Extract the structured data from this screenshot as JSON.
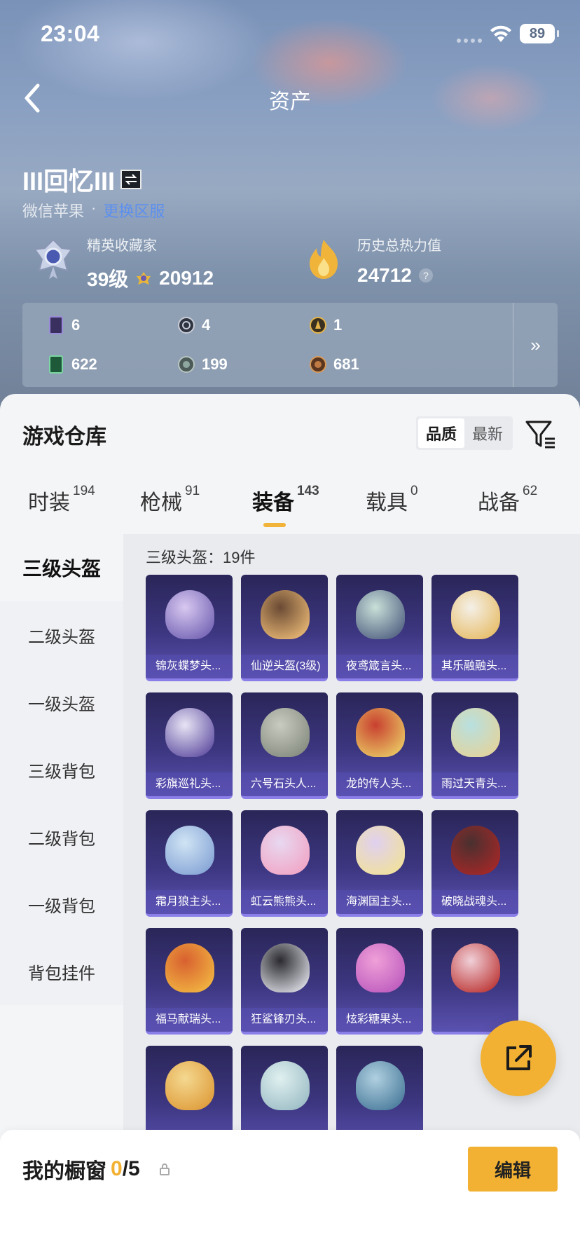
{
  "status_bar": {
    "time": "23:04",
    "battery": "89"
  },
  "nav": {
    "title": "资产"
  },
  "profile": {
    "username": "III回忆III",
    "platform": "微信苹果",
    "platform_link": "更换区服"
  },
  "stats": {
    "collector_label": "精英收藏家",
    "level": "39级",
    "collector_points": "20912",
    "heat_label": "历史总热力值",
    "heat_value": "24712",
    "help": "?"
  },
  "resources": [
    {
      "icon": "card-purple-icon",
      "value": "6"
    },
    {
      "icon": "coin-silver-icon",
      "value": "4"
    },
    {
      "icon": "coin-gold-icon",
      "value": "1"
    },
    {
      "icon": "card-green-icon",
      "value": "622"
    },
    {
      "icon": "coin-gray-icon",
      "value": "199"
    },
    {
      "icon": "coin-bronze-icon",
      "value": "681"
    }
  ],
  "resources_more": "»",
  "warehouse": {
    "title": "游戏仓库",
    "sort_options": [
      "品质",
      "最新"
    ],
    "tabs": [
      {
        "label": "时装",
        "count": "194"
      },
      {
        "label": "枪械",
        "count": "91"
      },
      {
        "label": "装备",
        "count": "143"
      },
      {
        "label": "载具",
        "count": "0"
      },
      {
        "label": "战备",
        "count": "62"
      }
    ],
    "categories": [
      "三级头盔",
      "二级头盔",
      "一级头盔",
      "三级背包",
      "二级背包",
      "一级背包",
      "背包挂件"
    ],
    "count_label": "三级头盔：19件",
    "items": [
      "锦灰蝶梦头...",
      "仙逆头盔(3级)",
      "夜鸢箴言头...",
      "其乐融融头...",
      "彩旗巡礼头...",
      "六号石头人...",
      "龙的传人头...",
      "雨过天青头...",
      "霜月狼主头...",
      "虹云熊熊头...",
      "海渊国主头...",
      "破晓战魂头...",
      "福马献瑞头...",
      "狂鲨锋刃头...",
      "炫彩糖果头...",
      "",
      "",
      "",
      ""
    ]
  },
  "showcase": {
    "label": "我的橱窗",
    "current": "0",
    "total": "/5",
    "edit": "编辑"
  },
  "colors": {
    "accent": "#f2b132",
    "card_bg": "#3c3680",
    "link": "#5c8ff0"
  }
}
